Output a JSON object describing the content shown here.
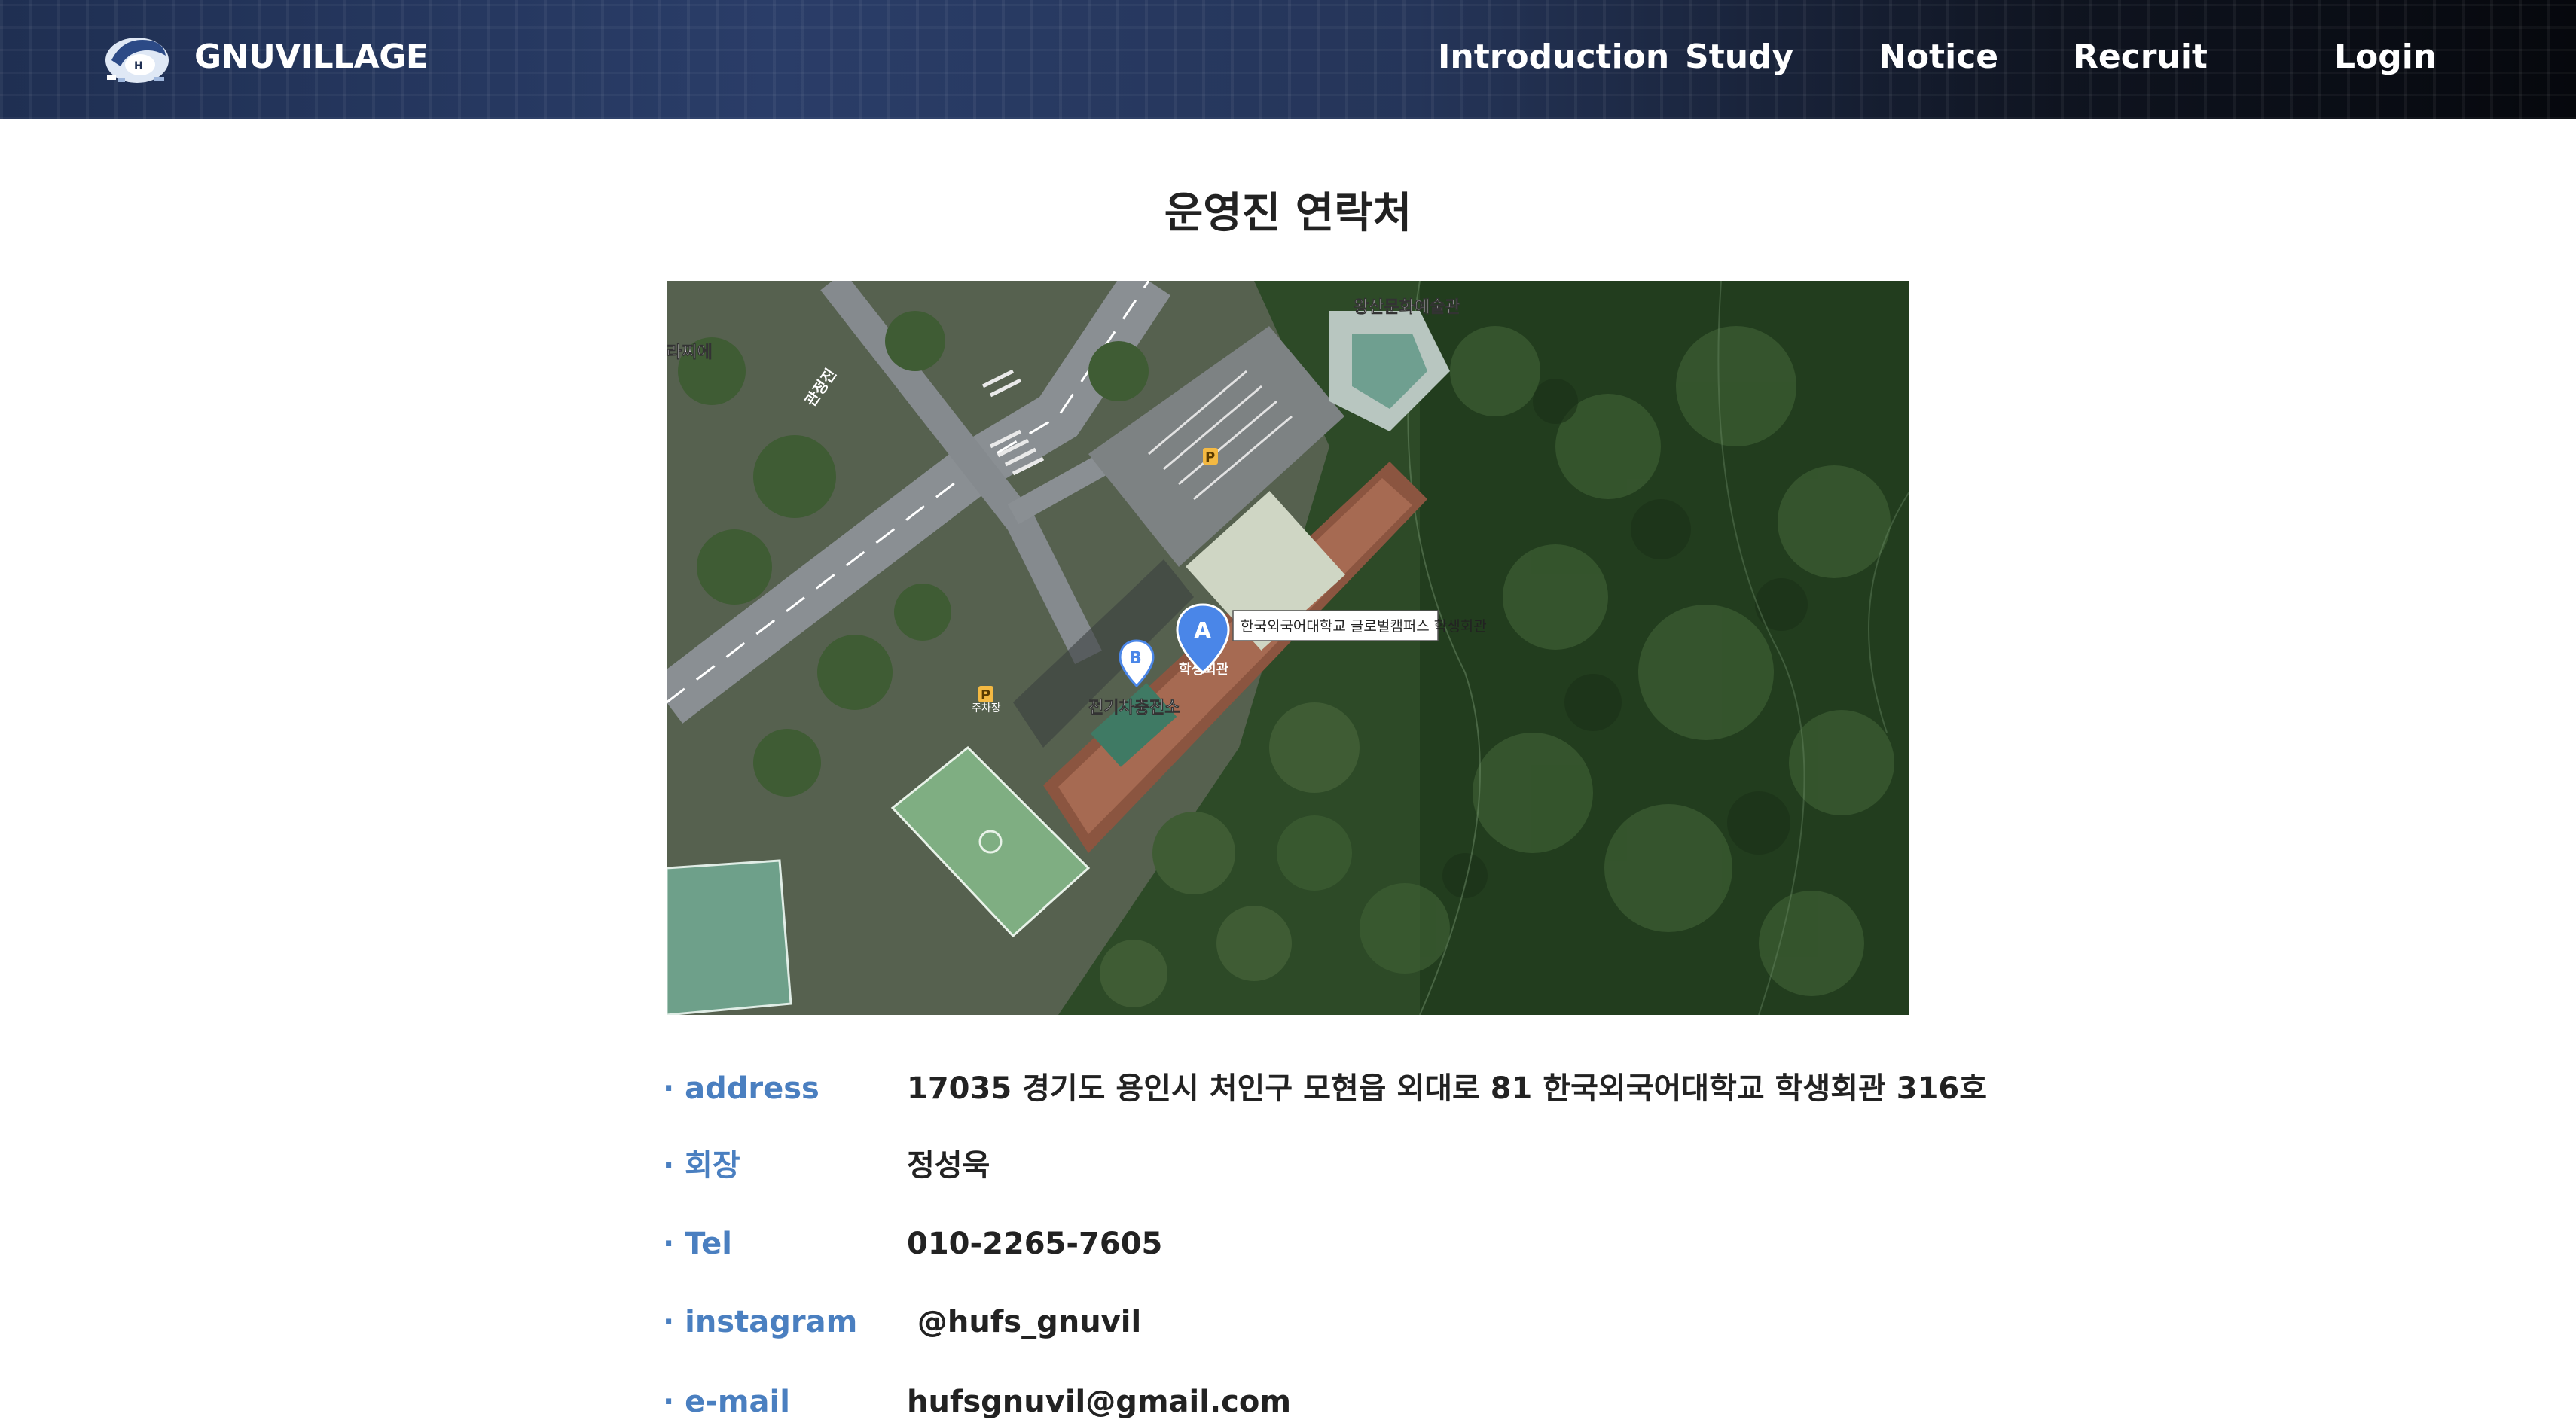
{
  "header": {
    "brand": "GNUVILLAGE",
    "nav": [
      "Introduction",
      "Study",
      "Notice",
      "Recruit",
      "Login"
    ]
  },
  "page": {
    "title": "운영진 연락처"
  },
  "map": {
    "labels": {
      "top_building": "왕산문화예술관",
      "left_shop": "라찌에",
      "road": "관정진",
      "callout": "한국외국어대학교 글로벌캠퍼스 학생회관",
      "student_hall": "학생회관",
      "ev_station": "전기차충전소",
      "parking_small": "주차장"
    },
    "markers": [
      "A",
      "B"
    ],
    "parking_icon": "P"
  },
  "contacts": [
    {
      "label": "· address",
      "value": "17035 경기도 용인시 처인구 모현읍 외대로 81 한국외국어대학교 학생회관 316호"
    },
    {
      "label": "· 회장",
      "value": "정성욱"
    },
    {
      "label": "· Tel",
      "value": "010-2265-7605"
    },
    {
      "label": "· instagram",
      "value": " @hufs_gnuvil"
    },
    {
      "label": "· e-mail",
      "value": "hufsgnuvil@gmail.com"
    }
  ],
  "colors": {
    "label_blue": "#4a7fc0",
    "header_dark": "#1f2f52",
    "marker_blue": "#4a86e8"
  }
}
